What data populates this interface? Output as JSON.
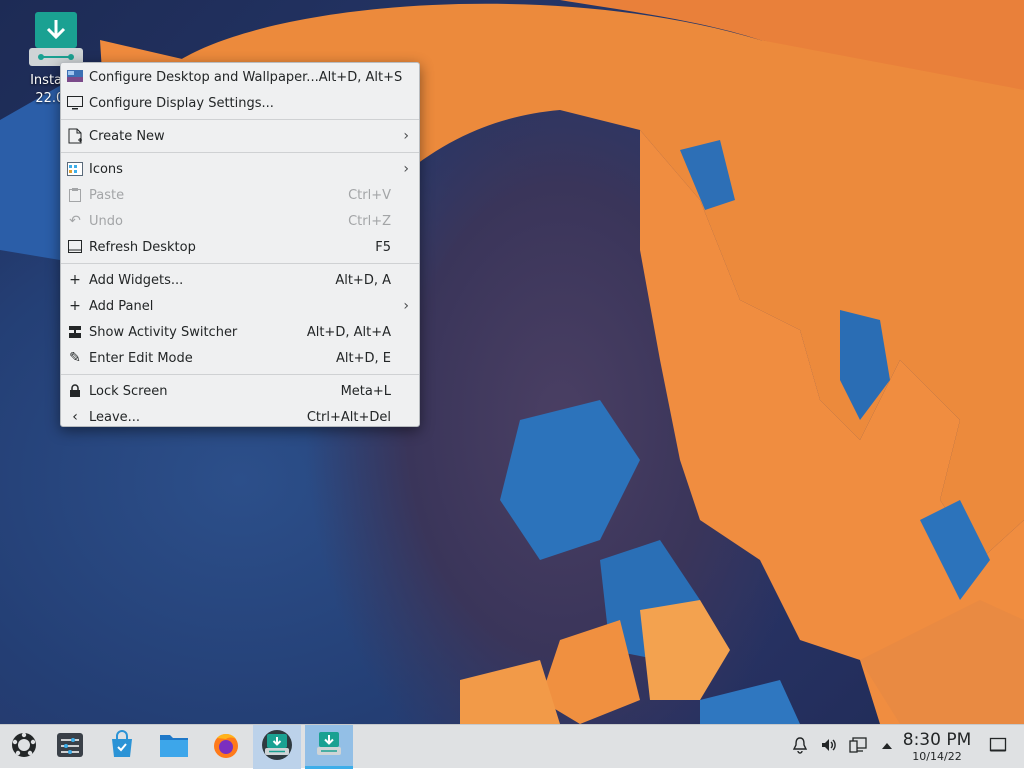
{
  "desktop": {
    "install_icon": {
      "label_line1": "Install K",
      "label_line2": "22.04."
    }
  },
  "context_menu": {
    "items": [
      {
        "label": "Configure Desktop and Wallpaper...",
        "shortcut": "Alt+D, Alt+S",
        "icon": "wallpaper-icon",
        "enabled": true
      },
      {
        "label": "Configure Display Settings...",
        "shortcut": "",
        "icon": "display-icon",
        "enabled": true
      },
      {
        "label": "Create New",
        "shortcut": "",
        "icon": "new-file-icon",
        "enabled": true,
        "submenu": true
      },
      {
        "label": "Icons",
        "shortcut": "",
        "icon": "icons-view-icon",
        "enabled": true,
        "submenu": true
      },
      {
        "label": "Paste",
        "shortcut": "Ctrl+V",
        "icon": "paste-icon",
        "enabled": false
      },
      {
        "label": "Undo",
        "shortcut": "Ctrl+Z",
        "icon": "undo-icon",
        "enabled": false
      },
      {
        "label": "Refresh Desktop",
        "shortcut": "F5",
        "icon": "refresh-icon",
        "enabled": true
      },
      {
        "label": "Add Widgets...",
        "shortcut": "Alt+D, A",
        "icon": "plus-icon",
        "enabled": true
      },
      {
        "label": "Add Panel",
        "shortcut": "",
        "icon": "plus-icon",
        "enabled": true,
        "submenu": true
      },
      {
        "label": "Show Activity Switcher",
        "shortcut": "Alt+D, Alt+A",
        "icon": "activities-icon",
        "enabled": true
      },
      {
        "label": "Enter Edit Mode",
        "shortcut": "Alt+D, E",
        "icon": "pencil-icon",
        "enabled": true
      },
      {
        "label": "Lock Screen",
        "shortcut": "Meta+L",
        "icon": "lock-icon",
        "enabled": true
      },
      {
        "label": "Leave...",
        "shortcut": "Ctrl+Alt+Del",
        "icon": "chevron-left-icon",
        "enabled": true
      }
    ]
  },
  "taskbar": {
    "launcher_icons": [
      "app-launcher-icon",
      "system-settings-icon",
      "discover-store-icon",
      "file-manager-icon",
      "firefox-icon",
      "installer-icon",
      "installer-window-icon"
    ],
    "tray_icons": [
      "notifications-icon",
      "volume-icon",
      "network-icon",
      "expand-tray-icon"
    ],
    "clock": {
      "time": "8:30 PM",
      "date": "10/14/22"
    }
  },
  "colors": {
    "menu_bg": "#eff0f1",
    "panel_bg": "#dfe1e3",
    "accent": "#3daee9",
    "wallpaper_orange": "#f08a3e",
    "wallpaper_blue": "#2a70b8"
  }
}
